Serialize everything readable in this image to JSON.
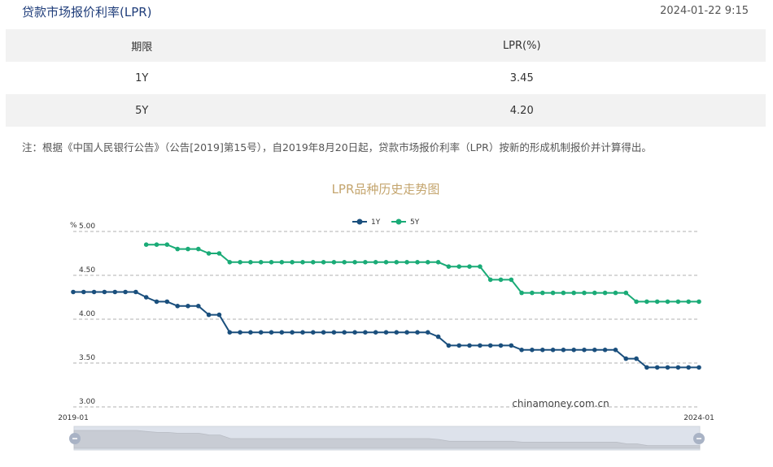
{
  "header": {
    "title": "贷款市场报价利率(LPR)",
    "datetime": "2024-01-22 9:15"
  },
  "table": {
    "headers": [
      "期限",
      "LPR(%)"
    ],
    "rows": [
      {
        "term": "1Y",
        "rate": "3.45"
      },
      {
        "term": "5Y",
        "rate": "4.20"
      }
    ]
  },
  "note": "注：根据《中国人民银行公告》（公告[2019]第15号），自2019年8月20日起，贷款市场报价利率（LPR）按新的形成机制报价并计算得出。",
  "colors": {
    "series_1y": "#1a4f7d",
    "series_5y": "#1aab77",
    "title": "#c4a56e",
    "grid": "#999999"
  },
  "chart_data": {
    "type": "line",
    "title": "LPR品种历史走势图",
    "ylabel": "%",
    "ylim": [
      3.0,
      5.0
    ],
    "yticks": [
      "5.00",
      "4.50",
      "4.00",
      "3.50",
      "3.00"
    ],
    "x_start_label": "2019-01",
    "x_end_label": "2024-01",
    "watermark": "chinamoney.com.cn",
    "legend_position": "top-center",
    "grid": true,
    "x_months": [
      "2019-01",
      "2019-02",
      "2019-03",
      "2019-04",
      "2019-05",
      "2019-06",
      "2019-07",
      "2019-08",
      "2019-09",
      "2019-10",
      "2019-11",
      "2019-12",
      "2020-01",
      "2020-02",
      "2020-03",
      "2020-04",
      "2020-05",
      "2020-06",
      "2020-07",
      "2020-08",
      "2020-09",
      "2020-10",
      "2020-11",
      "2020-12",
      "2021-01",
      "2021-02",
      "2021-03",
      "2021-04",
      "2021-05",
      "2021-06",
      "2021-07",
      "2021-08",
      "2021-09",
      "2021-10",
      "2021-11",
      "2021-12",
      "2022-01",
      "2022-02",
      "2022-03",
      "2022-04",
      "2022-05",
      "2022-06",
      "2022-07",
      "2022-08",
      "2022-09",
      "2022-10",
      "2022-11",
      "2022-12",
      "2023-01",
      "2023-02",
      "2023-03",
      "2023-04",
      "2023-05",
      "2023-06",
      "2023-07",
      "2023-08",
      "2023-09",
      "2023-10",
      "2023-11",
      "2023-12",
      "2024-01"
    ],
    "series": [
      {
        "name": "1Y",
        "values": [
          4.31,
          4.31,
          4.31,
          4.31,
          4.31,
          4.31,
          4.31,
          4.25,
          4.2,
          4.2,
          4.15,
          4.15,
          4.15,
          4.05,
          4.05,
          3.85,
          3.85,
          3.85,
          3.85,
          3.85,
          3.85,
          3.85,
          3.85,
          3.85,
          3.85,
          3.85,
          3.85,
          3.85,
          3.85,
          3.85,
          3.85,
          3.85,
          3.85,
          3.85,
          3.85,
          3.8,
          3.7,
          3.7,
          3.7,
          3.7,
          3.7,
          3.7,
          3.7,
          3.65,
          3.65,
          3.65,
          3.65,
          3.65,
          3.65,
          3.65,
          3.65,
          3.65,
          3.65,
          3.55,
          3.55,
          3.45,
          3.45,
          3.45,
          3.45,
          3.45,
          3.45
        ]
      },
      {
        "name": "5Y",
        "values": [
          null,
          null,
          null,
          null,
          null,
          null,
          null,
          4.85,
          4.85,
          4.85,
          4.8,
          4.8,
          4.8,
          4.75,
          4.75,
          4.65,
          4.65,
          4.65,
          4.65,
          4.65,
          4.65,
          4.65,
          4.65,
          4.65,
          4.65,
          4.65,
          4.65,
          4.65,
          4.65,
          4.65,
          4.65,
          4.65,
          4.65,
          4.65,
          4.65,
          4.65,
          4.6,
          4.6,
          4.6,
          4.6,
          4.45,
          4.45,
          4.45,
          4.3,
          4.3,
          4.3,
          4.3,
          4.3,
          4.3,
          4.3,
          4.3,
          4.3,
          4.3,
          4.3,
          4.2,
          4.2,
          4.2,
          4.2,
          4.2,
          4.2,
          4.2
        ]
      }
    ]
  }
}
